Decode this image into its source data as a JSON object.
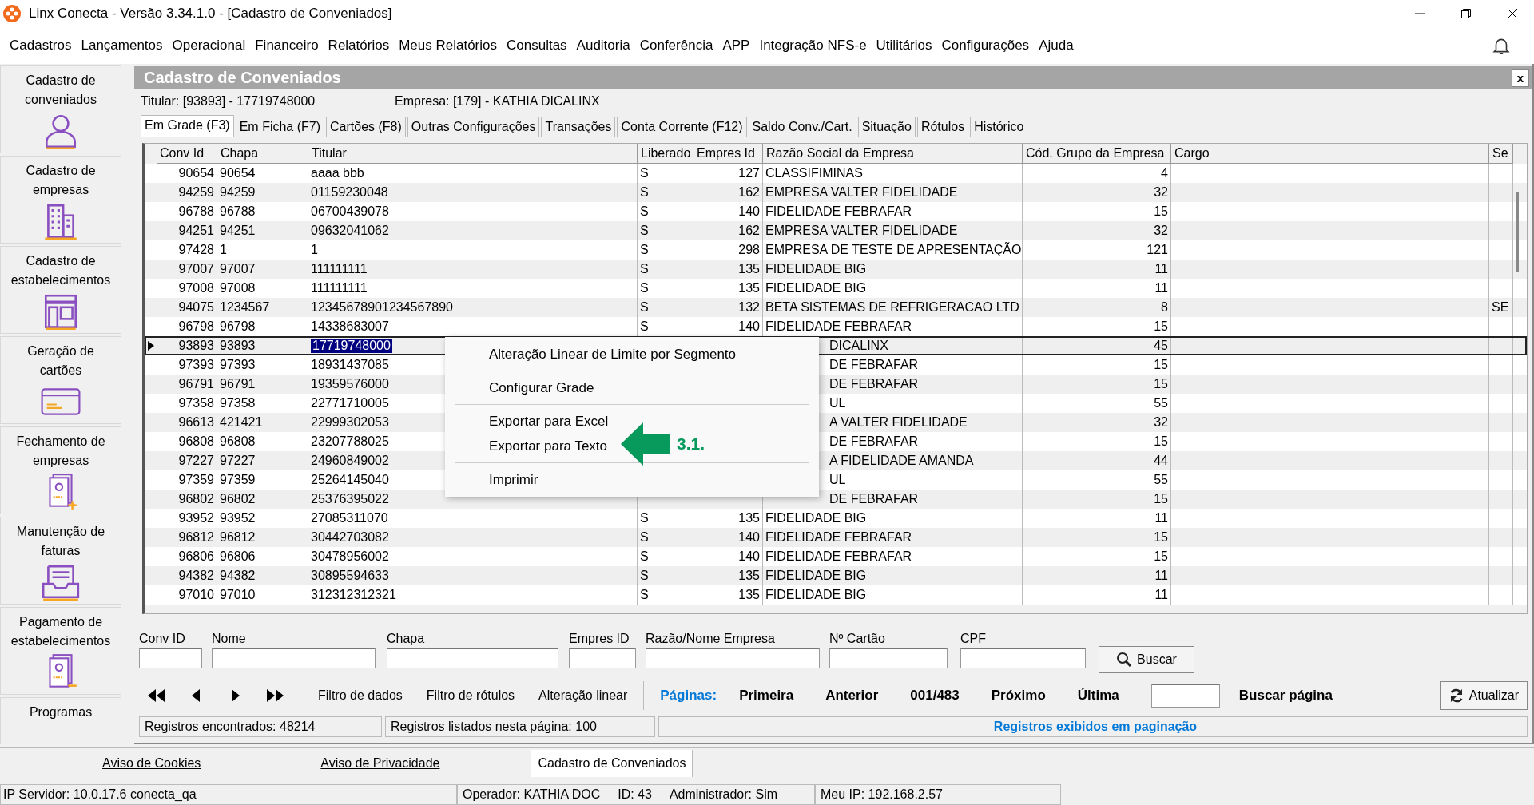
{
  "window": {
    "title": "Linx Conecta - Versão 3.34.1.0 - [Cadastro de Conveniados]"
  },
  "menu_bar": [
    "Cadastros",
    "Lançamentos",
    "Operacional",
    "Financeiro",
    "Relatórios",
    "Meus Relatórios",
    "Consultas",
    "Auditoria",
    "Conferência",
    "APP",
    "Integração NFS-e",
    "Utilitários",
    "Configurações",
    "Ajuda"
  ],
  "sidebar": {
    "items": [
      {
        "label": "Cadastro de conveniados",
        "kind": "person"
      },
      {
        "label": "Cadastro de empresas",
        "kind": "buildings"
      },
      {
        "label": "Cadastro de estabelecimentos",
        "kind": "store"
      },
      {
        "label": "Geração de cartões",
        "kind": "card"
      },
      {
        "label": "Fechamento de empresas",
        "kind": "invoice-plus"
      },
      {
        "label": "Manutenção de faturas",
        "kind": "tray"
      },
      {
        "label": "Pagamento de estabelecimentos",
        "kind": "invoice-minus"
      },
      {
        "label": "Programas",
        "kind": "none"
      }
    ]
  },
  "form": {
    "title": "Cadastro de Conveniados",
    "close": "x",
    "titular": "Titular: [93893] - 17719748000",
    "empresa": "Empresa: [179] - KATHIA DICALINX"
  },
  "tabs": [
    {
      "label": "Em Grade (F3)",
      "selected": true
    },
    {
      "label": "Em Ficha (F7)",
      "selected": false
    },
    {
      "label": "Cartões (F8)",
      "selected": false
    },
    {
      "label": "Outras Configurações",
      "selected": false
    },
    {
      "label": "Transações",
      "selected": false
    },
    {
      "label": "Conta Corrente (F12)",
      "selected": false
    },
    {
      "label": "Saldo Conv./Cart.",
      "selected": false
    },
    {
      "label": "Situação",
      "selected": false
    },
    {
      "label": "Rótulos",
      "selected": false
    },
    {
      "label": "Histórico",
      "selected": false
    }
  ],
  "grid": {
    "columns": [
      "Conv Id",
      "Chapa",
      "Titular",
      "Liberado",
      "Empres Id",
      "Razão Social da Empresa",
      "Cód. Grupo da Empresa",
      "Cargo",
      "Se"
    ],
    "rows": [
      {
        "selected": false,
        "conv_id": "90654",
        "chapa": "90654",
        "titular": "aaaa bbb",
        "liberado": "S",
        "empres_id": "127",
        "razao": "CLASSIFIMINAS",
        "cod_grupo": "4"
      },
      {
        "selected": false,
        "conv_id": "94259",
        "chapa": "94259",
        "titular": "01159230048",
        "liberado": "S",
        "empres_id": "162",
        "razao": "EMPRESA VALTER FIDELIDADE",
        "cod_grupo": "32"
      },
      {
        "selected": false,
        "conv_id": "96788",
        "chapa": "96788",
        "titular": "06700439078",
        "liberado": "S",
        "empres_id": "140",
        "razao": "FIDELIDADE FEBRAFAR",
        "cod_grupo": "15"
      },
      {
        "selected": false,
        "conv_id": "94251",
        "chapa": "94251",
        "titular": "09632041062",
        "liberado": "S",
        "empres_id": "162",
        "razao": "EMPRESA VALTER FIDELIDADE",
        "cod_grupo": "32"
      },
      {
        "selected": false,
        "conv_id": "97428",
        "chapa": "1",
        "titular": "1",
        "liberado": "S",
        "empres_id": "298",
        "razao": "EMPRESA DE TESTE DE APRESENTAÇÃO",
        "cod_grupo": "121"
      },
      {
        "selected": false,
        "conv_id": "97007",
        "chapa": "97007",
        "titular": "111111111",
        "liberado": "S",
        "empres_id": "135",
        "razao": "FIDELIDADE BIG",
        "cod_grupo": "11"
      },
      {
        "selected": false,
        "conv_id": "97008",
        "chapa": "97008",
        "titular": "111111111",
        "liberado": "S",
        "empres_id": "135",
        "razao": "FIDELIDADE BIG",
        "cod_grupo": "11"
      },
      {
        "selected": false,
        "conv_id": "94075",
        "chapa": "1234567",
        "titular": "12345678901234567890",
        "liberado": "S",
        "empres_id": "132",
        "razao": "BETA SISTEMAS DE REFRIGERACAO LTD",
        "cod_grupo": "8",
        "column_9": "SE"
      },
      {
        "selected": false,
        "conv_id": "96798",
        "chapa": "96798",
        "titular": "14338683007",
        "liberado": "S",
        "empres_id": "140",
        "razao": "FIDELIDADE FEBRAFAR",
        "cod_grupo": "15"
      },
      {
        "selected": true,
        "covered": true,
        "conv_id": "93893",
        "chapa": "93893",
        "titular": "17719748000",
        "razao": "DICALINX",
        "cod_grupo": "45"
      },
      {
        "selected": false,
        "covered": true,
        "conv_id": "97393",
        "chapa": "97393",
        "titular": "18931437085",
        "razao": "DE FEBRAFAR",
        "cod_grupo": "15"
      },
      {
        "selected": false,
        "covered": true,
        "conv_id": "96791",
        "chapa": "96791",
        "titular": "19359576000",
        "razao": "DE FEBRAFAR",
        "cod_grupo": "15"
      },
      {
        "selected": false,
        "covered": true,
        "conv_id": "97358",
        "chapa": "97358",
        "titular": "22771710005",
        "razao": "UL",
        "cod_grupo": "55"
      },
      {
        "selected": false,
        "covered": true,
        "conv_id": "96613",
        "chapa": "421421",
        "titular": "22999302053",
        "razao": "A VALTER FIDELIDADE",
        "cod_grupo": "32"
      },
      {
        "selected": false,
        "covered": true,
        "conv_id": "96808",
        "chapa": "96808",
        "titular": "23207788025",
        "razao": "DE FEBRAFAR",
        "cod_grupo": "15"
      },
      {
        "selected": false,
        "covered": true,
        "conv_id": "97227",
        "chapa": "97227",
        "titular": "24960849002",
        "razao": "A FIDELIDADE AMANDA",
        "cod_grupo": "44"
      },
      {
        "selected": false,
        "covered": true,
        "conv_id": "97359",
        "chapa": "97359",
        "titular": "25264145040",
        "razao": "UL",
        "cod_grupo": "55"
      },
      {
        "selected": false,
        "covered": true,
        "conv_id": "96802",
        "chapa": "96802",
        "titular": "25376395022",
        "razao": "DE FEBRAFAR",
        "cod_grupo": "15"
      },
      {
        "selected": false,
        "conv_id": "93952",
        "chapa": "93952",
        "titular": "27085311070",
        "liberado": "S",
        "empres_id": "135",
        "razao": "FIDELIDADE BIG",
        "cod_grupo": "11"
      },
      {
        "selected": false,
        "conv_id": "96812",
        "chapa": "96812",
        "titular": "30442703082",
        "liberado": "S",
        "empres_id": "140",
        "razao": "FIDELIDADE FEBRAFAR",
        "cod_grupo": "15"
      },
      {
        "selected": false,
        "conv_id": "96806",
        "chapa": "96806",
        "titular": "30478956002",
        "liberado": "S",
        "empres_id": "140",
        "razao": "FIDELIDADE FEBRAFAR",
        "cod_grupo": "15"
      },
      {
        "selected": false,
        "conv_id": "94382",
        "chapa": "94382",
        "titular": "30895594633",
        "liberado": "S",
        "empres_id": "135",
        "razao": "FIDELIDADE BIG",
        "cod_grupo": "11"
      },
      {
        "selected": false,
        "conv_id": "97010",
        "chapa": "97010",
        "titular": "312312312321",
        "liberado": "S",
        "empres_id": "135",
        "razao": "FIDELIDADE BIG",
        "cod_grupo": "11"
      }
    ]
  },
  "context_menu": [
    {
      "kind": "item",
      "label": "Alteração Linear de Limite por Segmento"
    },
    {
      "kind": "separator"
    },
    {
      "kind": "item",
      "label": "Configurar Grade"
    },
    {
      "kind": "separator"
    },
    {
      "kind": "item",
      "label": "Exportar para Excel"
    },
    {
      "kind": "item",
      "label": "Exportar para Texto"
    },
    {
      "kind": "separator"
    },
    {
      "kind": "item",
      "label": "Imprimir"
    }
  ],
  "annotation": {
    "label": "3.1."
  },
  "filters": [
    {
      "label": "Conv ID"
    },
    {
      "label": "Nome"
    },
    {
      "label": "Chapa"
    },
    {
      "label": "Empres ID"
    },
    {
      "label": "Razão/Nome Empresa"
    },
    {
      "label": "Nº Cartão"
    },
    {
      "label": "CPF"
    }
  ],
  "search_button": "Buscar",
  "grid_actions": [
    "Filtro de dados",
    "Filtro de rótulos",
    "Alteração linear"
  ],
  "pagination": {
    "label": "Páginas:",
    "first": "Primeira",
    "previous": "Anterior",
    "current": "001/483",
    "next": "Próximo",
    "last": "Última",
    "go_label": "Buscar página",
    "refresh": "Atualizar"
  },
  "record_status": {
    "found": "Registros encontrados: 48214",
    "listed": "Registros listados nesta página: 100",
    "mode": "Registros exibidos em paginação"
  },
  "footer_links": [
    "Aviso de Cookies",
    "Aviso de Privacidade"
  ],
  "open_windows": [
    {
      "label": "Cadastro de Conveniados",
      "selected": true
    }
  ],
  "status_bar": {
    "server": "IP Servidor: 10.0.17.6 conecta_qa",
    "operator": "Operador: KATHIA DOC",
    "id": "ID: 43",
    "admin": "Administrador: Sim",
    "my_ip": "Meu IP: 192.168.2.57"
  }
}
